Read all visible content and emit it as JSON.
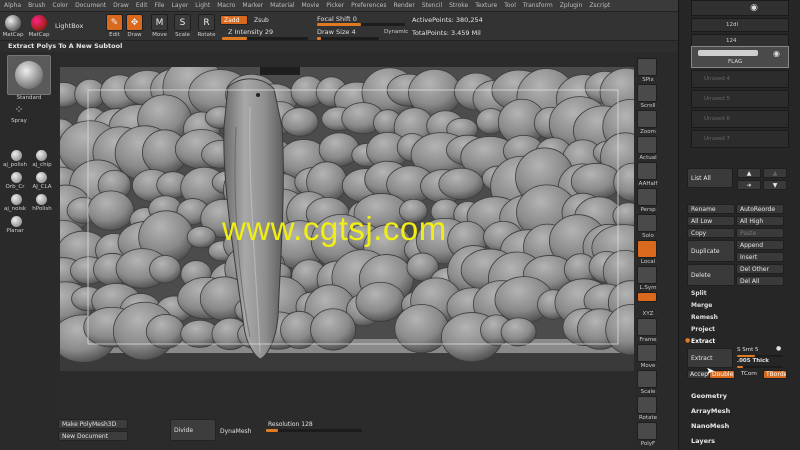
{
  "menu": [
    "Alpha",
    "Brush",
    "Color",
    "Document",
    "Draw",
    "Edit",
    "File",
    "Layer",
    "Light",
    "Macro",
    "Marker",
    "Material",
    "Movie",
    "Picker",
    "Preferences",
    "Render",
    "Stencil",
    "Stroke",
    "Texture",
    "Tool",
    "Transform",
    "Zplugin",
    "Zscript"
  ],
  "toolbar": {
    "matcap1": "MatCap",
    "matcap2": "MatCap",
    "lightbox": "LightBox",
    "edit": "Edit",
    "draw": "Draw",
    "move": "Move",
    "scale": "Scale",
    "rotate": "Rotate",
    "zadd": "Zadd",
    "zsub": "Zsub",
    "z_intensity": "Z Intensity 29",
    "focal_shift": "Focal Shift 0",
    "draw_size": "Draw Size 4",
    "dynamic": "Dynamic",
    "active_points": "ActivePoints: 380,254",
    "total_points": "TotalPoints: 3.459 Mil",
    "z_intensity_value": 0.29,
    "focal_shift_value": 0.5,
    "draw_size_value": 0.04
  },
  "title": "Extract Polys To A New Subtool",
  "left_shelf": {
    "standard": "Standard",
    "spray": "Spray",
    "brushes": [
      "aj_polish",
      "aj_chip",
      "Orb_Cr",
      "AJ_CLA",
      "aj_noisk",
      "hPolish",
      "Planar"
    ]
  },
  "right_shelf": [
    "SPix",
    "Scroll",
    "Zoom",
    "Actual",
    "AAHalf",
    "Persp",
    "Solo",
    "Local",
    "L.Sym",
    "XYZ",
    "Frame",
    "Move",
    "Scale",
    "Rotate",
    "PolyF"
  ],
  "bottom": {
    "make_polymesh": "Make PolyMesh3D",
    "new_document": "New Document",
    "divide": "Divide",
    "dynamesh": "DynaMesh",
    "resolution": "Resolution 128",
    "resolution_value": 0.128
  },
  "watermark": "www.cgtsj.com",
  "subtool_panel": {
    "slot_label_1": "12dl",
    "slot_label_2": "124",
    "flag": "FLAG",
    "unused": [
      "Unused 4",
      "Unused 5",
      "Unused 6",
      "Unused 7"
    ],
    "list_all": "List All",
    "rename": "Rename",
    "auto_reorder": "AutoReorde",
    "all_low": "All Low",
    "all_high": "All High",
    "copy": "Copy",
    "paste": "Paste",
    "duplicate": "Duplicate",
    "append": "Append",
    "insert": "Insert",
    "delete": "Delete",
    "del_other": "Del Other",
    "del_all": "Del All",
    "split": "Split",
    "merge": "Merge",
    "remesh": "Remesh",
    "project": "Project",
    "extract_header": "Extract",
    "extract_btn": "Extract",
    "s_smt": "S Smt 5",
    "thick": ".005 Thick",
    "accept": "Accept",
    "double": "Double",
    "tcorn": "TCorn",
    "tborder": "TBorder",
    "geometry": "Geometry",
    "arraymesh": "ArrayMesh",
    "nanomesh": "NanoMesh",
    "layers": "Layers"
  },
  "colors": {
    "accent": "#d9691d",
    "watermark": "#f0ee12"
  }
}
